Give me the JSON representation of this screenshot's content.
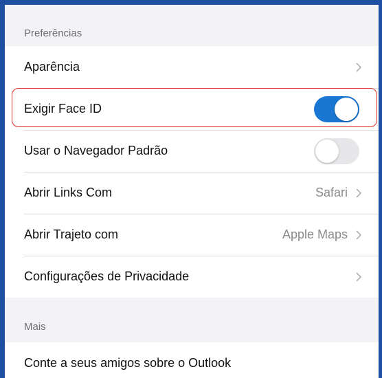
{
  "sections": {
    "preferences": {
      "header": "Preferências",
      "rows": {
        "appearance": {
          "label": "Aparência"
        },
        "face_id": {
          "label": "Exigir Face ID",
          "toggle": "on"
        },
        "default_browser": {
          "label": "Usar o Navegador Padrão",
          "toggle": "off"
        },
        "open_links": {
          "label": "Abrir Links Com",
          "value": "Safari"
        },
        "open_directions": {
          "label": "Abrir Trajeto com",
          "value": "Apple Maps"
        },
        "privacy": {
          "label": "Configurações de Privacidade"
        }
      }
    },
    "more": {
      "header": "Mais",
      "rows": {
        "tell_friends": {
          "label": "Conte a seus amigos sobre o Outlook"
        }
      }
    }
  },
  "colors": {
    "toggle_on": "#1976d2",
    "toggle_off": "#e7e7ea",
    "highlight": "#d93025",
    "frame_border": "#1f4fa3"
  },
  "icons": {
    "chevron": "chevron-right-icon"
  }
}
